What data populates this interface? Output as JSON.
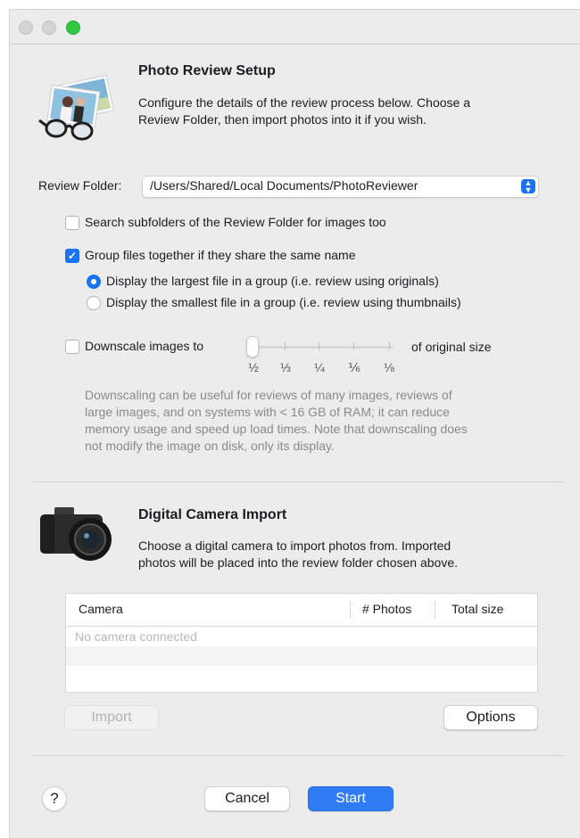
{
  "window": {
    "controls": [
      "close",
      "minimize",
      "zoom"
    ]
  },
  "photo_section": {
    "icon": "photos-and-glasses-icon",
    "title": "Photo Review Setup",
    "description_line1": "Configure the details of the review process below.  Choose a",
    "description_line2": "Review Folder, then import photos into it if you wish."
  },
  "review_folder": {
    "label": "Review Folder:",
    "value": "/Users/Shared/Local Documents/PhotoReviewer"
  },
  "options": {
    "search_subfolders": {
      "label": "Search subfolders of the Review Folder for images too",
      "checked": false
    },
    "group_files": {
      "label": "Group files together if they share the same name",
      "checked": true
    },
    "radio_largest": {
      "label": "Display the largest file in a group (i.e. review using originals)",
      "selected": true
    },
    "radio_smallest": {
      "label": "Display the smallest file in a group (i.e. review using thumbnails)",
      "selected": false
    },
    "downscale": {
      "label": "Downscale images to",
      "suffix": "of original size",
      "checked": false,
      "fractions": [
        "½",
        "⅓",
        "¼",
        "⅙",
        "⅛"
      ],
      "selected_index": 0
    },
    "downscale_note": [
      "Downscaling can be useful for reviews of many images, reviews of",
      "large images, and on systems with < 16 GB of RAM; it can reduce",
      "memory usage and speed up load times.  Note that downscaling does",
      "not modify the image on disk, only its display."
    ]
  },
  "camera_section": {
    "icon": "camera-icon",
    "title": "Digital Camera Import",
    "description_line1": "Choose a digital camera to import photos from.  Imported",
    "description_line2": "photos will be placed into the review folder chosen above.",
    "table": {
      "columns": [
        "Camera",
        "# Photos",
        "Total size"
      ],
      "empty_message": "No camera connected"
    },
    "import_label": "Import",
    "options_label": "Options"
  },
  "footer": {
    "help_label": "?",
    "cancel_label": "Cancel",
    "start_label": "Start"
  },
  "colors": {
    "accent": "#1a73f2",
    "primary_button": "#2f7cf6",
    "zoom_button": "#2ec841"
  }
}
